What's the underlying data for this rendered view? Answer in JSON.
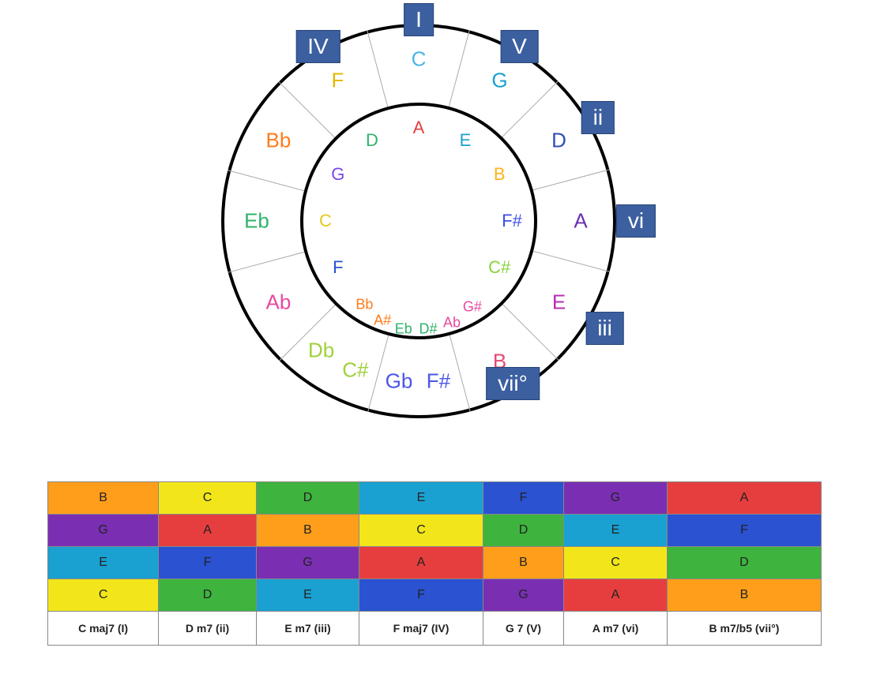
{
  "circle": {
    "outer": [
      {
        "t": "C",
        "c": "#4cb4e7",
        "a": 0
      },
      {
        "t": "G",
        "c": "#1aa0d1",
        "a": 30
      },
      {
        "t": "D",
        "c": "#2f4fb3",
        "a": 60
      },
      {
        "t": "A",
        "c": "#6b2fb3",
        "a": 90
      },
      {
        "t": "E",
        "c": "#b82fb3",
        "a": 120
      },
      {
        "t": "B",
        "c": "#e64a73",
        "a": 150
      },
      {
        "t": "F#",
        "c": "#4a56e6",
        "a": 173
      },
      {
        "t": "Gb",
        "c": "#4a56e6",
        "a": 187
      },
      {
        "t": "C#",
        "c": "#a0d13a",
        "a": 203
      },
      {
        "t": "Db",
        "c": "#a0d13a",
        "a": 217
      },
      {
        "t": "Ab",
        "c": "#e64a9e",
        "a": 240
      },
      {
        "t": "Eb",
        "c": "#2fb36b",
        "a": 270
      },
      {
        "t": "Bb",
        "c": "#ff7b1a",
        "a": 300
      },
      {
        "t": "F",
        "c": "#e6b800",
        "a": 330
      }
    ],
    "inner": [
      {
        "t": "A",
        "c": "#e63e3e",
        "a": 0
      },
      {
        "t": "E",
        "c": "#1aa0d1",
        "a": 30
      },
      {
        "t": "B",
        "c": "#ffb31a",
        "a": 60
      },
      {
        "t": "F#",
        "c": "#3a4de6",
        "a": 90
      },
      {
        "t": "C#",
        "c": "#8ad13a",
        "a": 120
      },
      {
        "t": "D",
        "c": "#2fb36b",
        "a": 330
      },
      {
        "t": "G",
        "c": "#7a48e6",
        "a": 300
      },
      {
        "t": "C",
        "c": "#e6c81a",
        "a": 270
      },
      {
        "t": "F",
        "c": "#2a52d1",
        "a": 240
      }
    ],
    "overflow": [
      {
        "t": "G#",
        "c": "#e64a9e",
        "a": 148,
        "r": 128
      },
      {
        "t": "Ab",
        "c": "#e64a9e",
        "a": 162,
        "r": 136
      },
      {
        "t": "D#",
        "c": "#2fb36b",
        "a": 175,
        "r": 138
      },
      {
        "t": "Eb",
        "c": "#2fb36b",
        "a": 188,
        "r": 138
      },
      {
        "t": "A#",
        "c": "#ff7b1a",
        "a": 200,
        "r": 134
      },
      {
        "t": "Bb",
        "c": "#ff7b1a",
        "a": 213,
        "r": 126
      }
    ],
    "romans": [
      {
        "t": "I",
        "a": 0,
        "r": 255
      },
      {
        "t": "V",
        "a": 30,
        "r": 255
      },
      {
        "t": "ii",
        "a": 60,
        "r": 262
      },
      {
        "t": "vi",
        "a": 90,
        "r": 275
      },
      {
        "t": "iii",
        "a": 120,
        "r": 272
      },
      {
        "t": "vii°",
        "a": 150,
        "r": 238
      },
      {
        "t": "IV",
        "a": 330,
        "r": 255
      }
    ]
  },
  "table": {
    "rows": [
      [
        {
          "n": "B",
          "c": "#ff9e1a"
        },
        {
          "n": "C",
          "c": "#f2e61a"
        },
        {
          "n": "D",
          "c": "#3eb33e"
        },
        {
          "n": "E",
          "c": "#1aa0d1"
        },
        {
          "n": "F",
          "c": "#2a52d1"
        },
        {
          "n": "G",
          "c": "#7a2fb3"
        },
        {
          "n": "A",
          "c": "#e63e3e"
        }
      ],
      [
        {
          "n": "G",
          "c": "#7a2fb3"
        },
        {
          "n": "A",
          "c": "#e63e3e"
        },
        {
          "n": "B",
          "c": "#ff9e1a"
        },
        {
          "n": "C",
          "c": "#f2e61a"
        },
        {
          "n": "D",
          "c": "#3eb33e"
        },
        {
          "n": "E",
          "c": "#1aa0d1"
        },
        {
          "n": "F",
          "c": "#2a52d1"
        }
      ],
      [
        {
          "n": "E",
          "c": "#1aa0d1"
        },
        {
          "n": "F",
          "c": "#2a52d1"
        },
        {
          "n": "G",
          "c": "#7a2fb3"
        },
        {
          "n": "A",
          "c": "#e63e3e"
        },
        {
          "n": "B",
          "c": "#ff9e1a"
        },
        {
          "n": "C",
          "c": "#f2e61a"
        },
        {
          "n": "D",
          "c": "#3eb33e"
        }
      ],
      [
        {
          "n": "C",
          "c": "#f2e61a"
        },
        {
          "n": "D",
          "c": "#3eb33e"
        },
        {
          "n": "E",
          "c": "#1aa0d1"
        },
        {
          "n": "F",
          "c": "#2a52d1"
        },
        {
          "n": "G",
          "c": "#7a2fb3"
        },
        {
          "n": "A",
          "c": "#e63e3e"
        },
        {
          "n": "B",
          "c": "#ff9e1a"
        }
      ]
    ],
    "footer": [
      "C maj7 (I)",
      "D m7 (ii)",
      "E m7 (iii)",
      "F maj7 (IV)",
      "G 7 (V)",
      "A m7 (vi)",
      "B m7/b5 (vii°)"
    ]
  }
}
